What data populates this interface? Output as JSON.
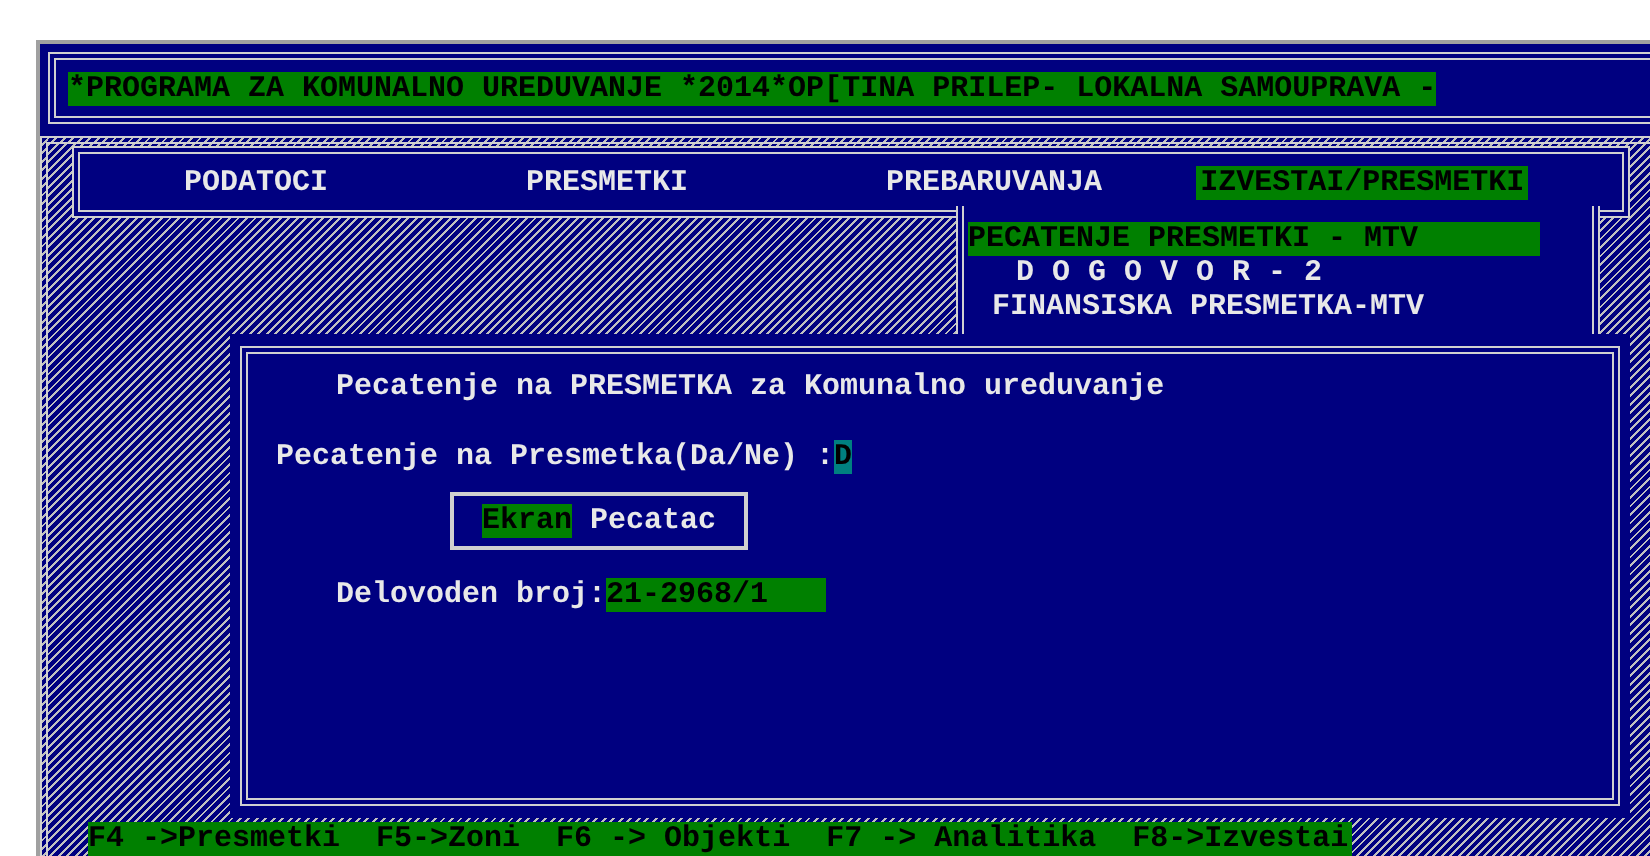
{
  "title_bar": {
    "text": "*PROGRAMA ZA KOMUNALNO UREDUVANJE *2014*OP[TINA PRILEP- LOKALNA SAMOUPRAVA -"
  },
  "menu": [
    {
      "label": "PODATOCI",
      "selected": false
    },
    {
      "label": "PRESMETKI",
      "selected": false
    },
    {
      "label": "PREBARUVANJA",
      "selected": false
    },
    {
      "label": "IZVESTAI/PRESMETKI",
      "selected": true
    }
  ],
  "submenu": [
    {
      "label": "PECATENJE PRESMETKI - MTV",
      "selected": true
    },
    {
      "label": "D O G O V O R - 2",
      "selected": false
    },
    {
      "label": "FINANSISKA PRESMETKA-MTV",
      "selected": false
    }
  ],
  "dialog": {
    "title": "Pecatenje na PRESMETKA za Komunalno ureduvanje",
    "print_field": {
      "label": "Pecatenje na Presmetka(Da/Ne) :",
      "value": "D"
    },
    "output_options": [
      {
        "label": "Ekran",
        "selected": true
      },
      {
        "label": "Pecatac",
        "selected": false
      }
    ],
    "number_field": {
      "label": "Delovoden broj:",
      "value": "21-2968/1"
    }
  },
  "status_bar": [
    "F4 ->Presmetki",
    "F5->Zoni",
    "F6 -> Objekti",
    "F7 -> Analitika",
    "F8->Izvestai"
  ]
}
